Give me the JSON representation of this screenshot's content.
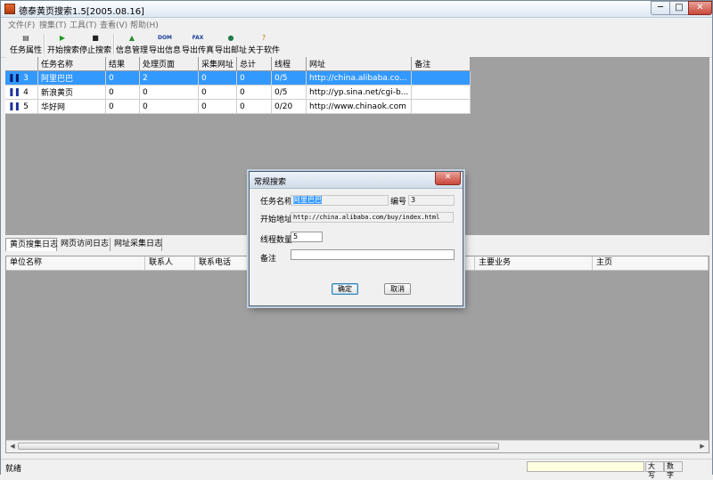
{
  "window": {
    "title": "德泰黄页搜索1.5[2005.08.16]",
    "min": "─",
    "max": "□",
    "close": "✕"
  },
  "menu": [
    "文件(F)",
    "搜集(T)",
    "工具(T)",
    "查看(V)",
    "帮助(H)"
  ],
  "toolbar": [
    {
      "label": "任务属性",
      "icon": "properties-icon",
      "glyph": "▤",
      "color": "#333333"
    },
    {
      "label": "开始搜索",
      "icon": "play-icon",
      "glyph": "▶",
      "color": "#1f9a1f"
    },
    {
      "label": "停止搜索",
      "icon": "stop-icon",
      "glyph": "■",
      "color": "#222222"
    },
    {
      "label": "信息管理",
      "icon": "info-manage-icon",
      "glyph": "▲",
      "color": "#2b8a2b"
    },
    {
      "label": "导出信息",
      "icon": "export-dom-icon",
      "glyph": "DOM",
      "color": "#1b3f9a"
    },
    {
      "label": "导出传真",
      "icon": "export-fax-icon",
      "glyph": "FAX",
      "color": "#1b3f9a"
    },
    {
      "label": "导出邮址",
      "icon": "export-mail-icon",
      "glyph": "●",
      "color": "#1d7d4a"
    },
    {
      "label": "关于软件",
      "icon": "about-icon",
      "glyph": "?",
      "color": "#b8860b"
    }
  ],
  "tasks": {
    "columns": [
      "",
      "任务名称",
      "结果",
      "处理页面",
      "采集网址",
      "总计",
      "线程",
      "网址",
      "备注"
    ],
    "rows": [
      {
        "indicator": "❚❚",
        "id": "3",
        "name": "阿里巴巴",
        "result": "0",
        "pages": "2",
        "collected": "0",
        "total": "0",
        "threads": "0/5",
        "url": "http://china.alibaba.co...",
        "note": ""
      },
      {
        "indicator": "❚❚",
        "id": "4",
        "name": "新浪黄页",
        "result": "0",
        "pages": "0",
        "collected": "0",
        "total": "0",
        "threads": "0/5",
        "url": "http://yp.sina.net/cgi-b...",
        "note": ""
      },
      {
        "indicator": "❚❚",
        "id": "5",
        "name": "华好网",
        "result": "0",
        "pages": "0",
        "collected": "0",
        "total": "0",
        "threads": "0/20",
        "url": "http://www.chinaok.com",
        "note": ""
      }
    ]
  },
  "log_tabs": [
    "黄页搜集日志",
    "网页访问日志",
    "网址采集日志"
  ],
  "log_columns": [
    "单位名称",
    "联系人",
    "联系电话",
    "主要业务",
    "主页"
  ],
  "status": {
    "text": "就绪",
    "caps": "大写",
    "num": "数字"
  },
  "dialog": {
    "title": "常规搜索",
    "close": "✕",
    "task_name_label": "任务名称",
    "task_name_value": "阿里巴巴",
    "id_label": "编号",
    "id_value": "3",
    "start_url_label": "开始地址",
    "start_url_value": "http://china.alibaba.com/buy/index.html",
    "threads_label": "线程数量",
    "threads_value": "5",
    "note_label": "备注",
    "note_value": "",
    "ok": "确定",
    "cancel": "取消"
  }
}
